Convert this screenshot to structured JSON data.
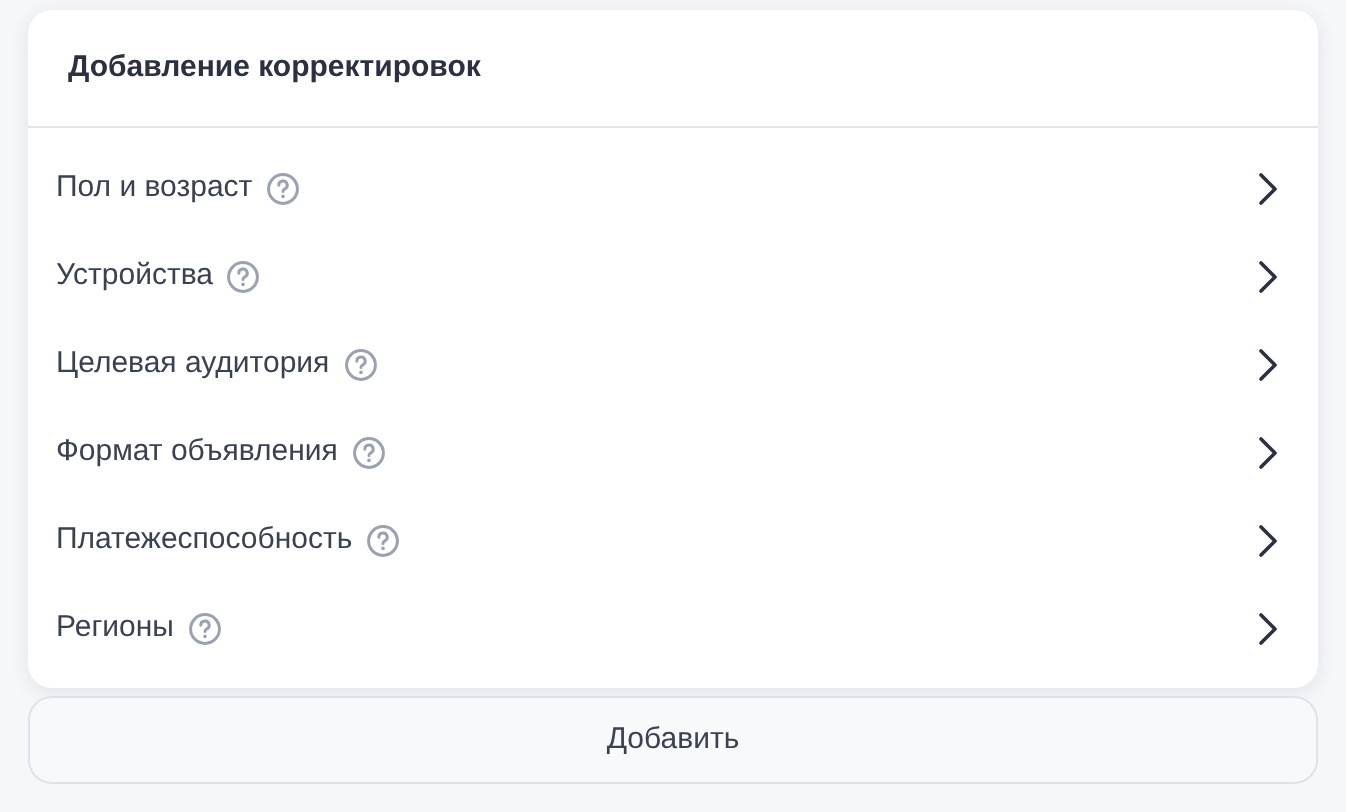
{
  "panel": {
    "title": "Добавление корректировок",
    "items": [
      {
        "label": "Пол и возраст"
      },
      {
        "label": "Устройства"
      },
      {
        "label": "Целевая аудитория"
      },
      {
        "label": "Формат объявления"
      },
      {
        "label": "Платежеспособность"
      },
      {
        "label": "Регионы"
      }
    ]
  },
  "button": {
    "label": "Добавить"
  }
}
